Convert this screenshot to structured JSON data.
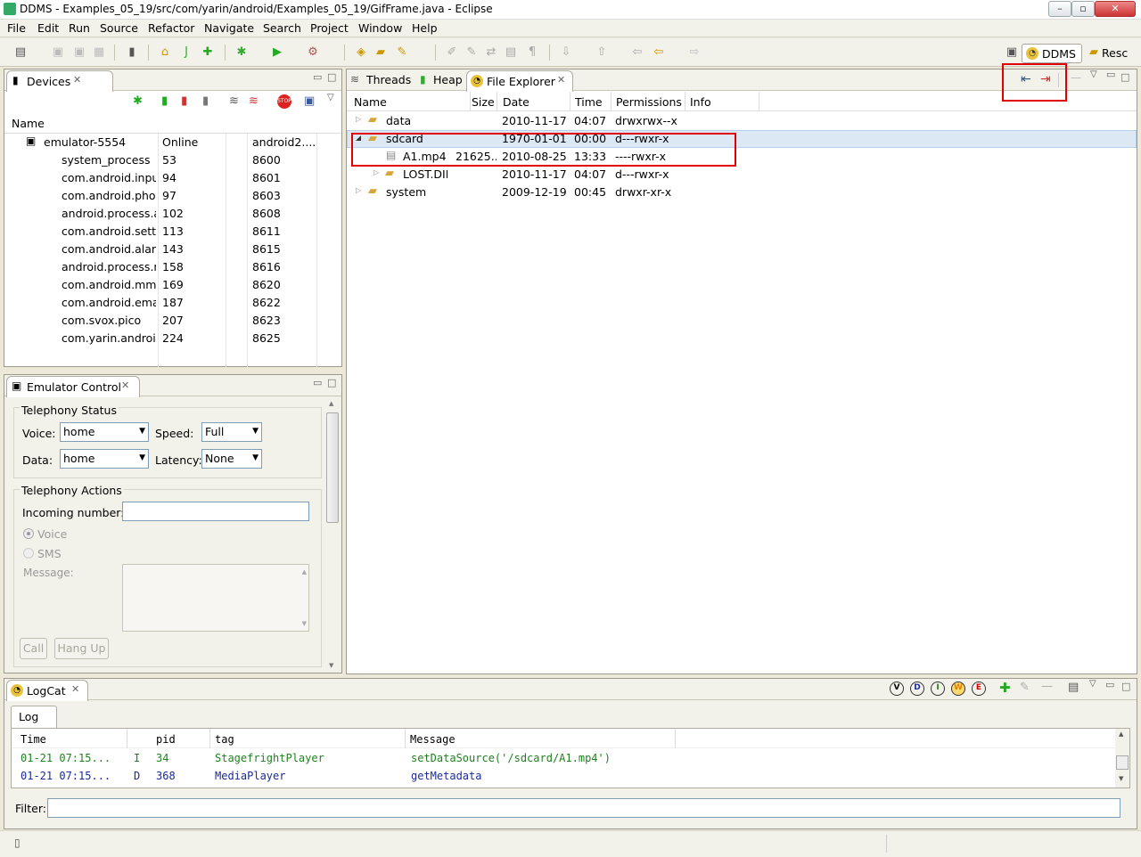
{
  "window": {
    "title": "DDMS - Examples_05_19/src/com/yarin/android/Examples_05_19/GifFrame.java - Eclipse",
    "min": "–",
    "max": "▫",
    "close": "✕"
  },
  "menu": [
    "File",
    "Edit",
    "Run",
    "Source",
    "Refactor",
    "Navigate",
    "Search",
    "Project",
    "Window",
    "Help"
  ],
  "perspectives": {
    "ddms": "DDMS",
    "resource": "Resc"
  },
  "devices": {
    "tab": "Devices",
    "col_name": "Name",
    "emulator": {
      "name": "emulator-5554",
      "status": "Online",
      "target": "android2...."
    },
    "processes": [
      {
        "name": "system_process",
        "pid": "53",
        "port": "8600"
      },
      {
        "name": "com.android.input",
        "pid": "94",
        "port": "8601"
      },
      {
        "name": "com.android.phon",
        "pid": "97",
        "port": "8603"
      },
      {
        "name": "android.process.a",
        "pid": "102",
        "port": "8608"
      },
      {
        "name": "com.android.settin",
        "pid": "113",
        "port": "8611"
      },
      {
        "name": "com.android.alarm",
        "pid": "143",
        "port": "8615"
      },
      {
        "name": "android.process.m",
        "pid": "158",
        "port": "8616"
      },
      {
        "name": "com.android.mms",
        "pid": "169",
        "port": "8620"
      },
      {
        "name": "com.android.email",
        "pid": "187",
        "port": "8622"
      },
      {
        "name": "com.svox.pico",
        "pid": "207",
        "port": "8623"
      },
      {
        "name": "com.yarin.android.",
        "pid": "224",
        "port": "8625"
      }
    ]
  },
  "emulator_control": {
    "tab": "Emulator Control",
    "telephony_status": "Telephony Status",
    "voice_label": "Voice:",
    "voice_value": "home",
    "speed_label": "Speed:",
    "speed_value": "Full",
    "data_label": "Data:",
    "data_value": "home",
    "latency_label": "Latency:",
    "latency_value": "None",
    "telephony_actions": "Telephony Actions",
    "incoming_label": "Incoming number:",
    "voice_radio": "Voice",
    "sms_radio": "SMS",
    "message_label": "Message:",
    "call_btn": "Call",
    "hangup_btn": "Hang Up"
  },
  "editor_tabs": {
    "threads": "Threads",
    "heap": "Heap",
    "file_explorer": "File Explorer"
  },
  "file_explorer": {
    "cols": {
      "name": "Name",
      "size": "Size",
      "date": "Date",
      "time": "Time",
      "permissions": "Permissions",
      "info": "Info"
    },
    "rows": [
      {
        "name": "data",
        "size": "",
        "date": "2010-11-17",
        "time": "04:07",
        "perm": "drwxrwx--x"
      },
      {
        "name": "sdcard",
        "size": "",
        "date": "1970-01-01",
        "time": "00:00",
        "perm": "d---rwxr-x"
      },
      {
        "name": "A1.mp4",
        "size": "21625...",
        "date": "2010-08-25",
        "time": "13:33",
        "perm": "----rwxr-x"
      },
      {
        "name": "LOST.DII",
        "size": "",
        "date": "2010-11-17",
        "time": "04:07",
        "perm": "d---rwxr-x"
      },
      {
        "name": "system",
        "size": "",
        "date": "2009-12-19",
        "time": "00:45",
        "perm": "drwxr-xr-x"
      }
    ]
  },
  "logcat": {
    "tab": "LogCat",
    "subtab": "Log",
    "levels": [
      "V",
      "D",
      "I",
      "W",
      "E"
    ],
    "cols": {
      "time": "Time",
      "pid": "pid",
      "tag": "tag",
      "message": "Message"
    },
    "rows": [
      {
        "time": "01-21 07:15...",
        "level": "I",
        "pid": "34",
        "tag": "StagefrightPlayer",
        "message": "setDataSource('/sdcard/A1.mp4')",
        "color": "#208020"
      },
      {
        "time": "01-21 07:15...",
        "level": "D",
        "pid": "368",
        "tag": "MediaPlayer",
        "message": "getMetadata",
        "color": "#1a2a9a"
      }
    ],
    "filter_label": "Filter:"
  },
  "colors": {
    "highlight": "#dde8f5",
    "annotation": "#e00000"
  }
}
